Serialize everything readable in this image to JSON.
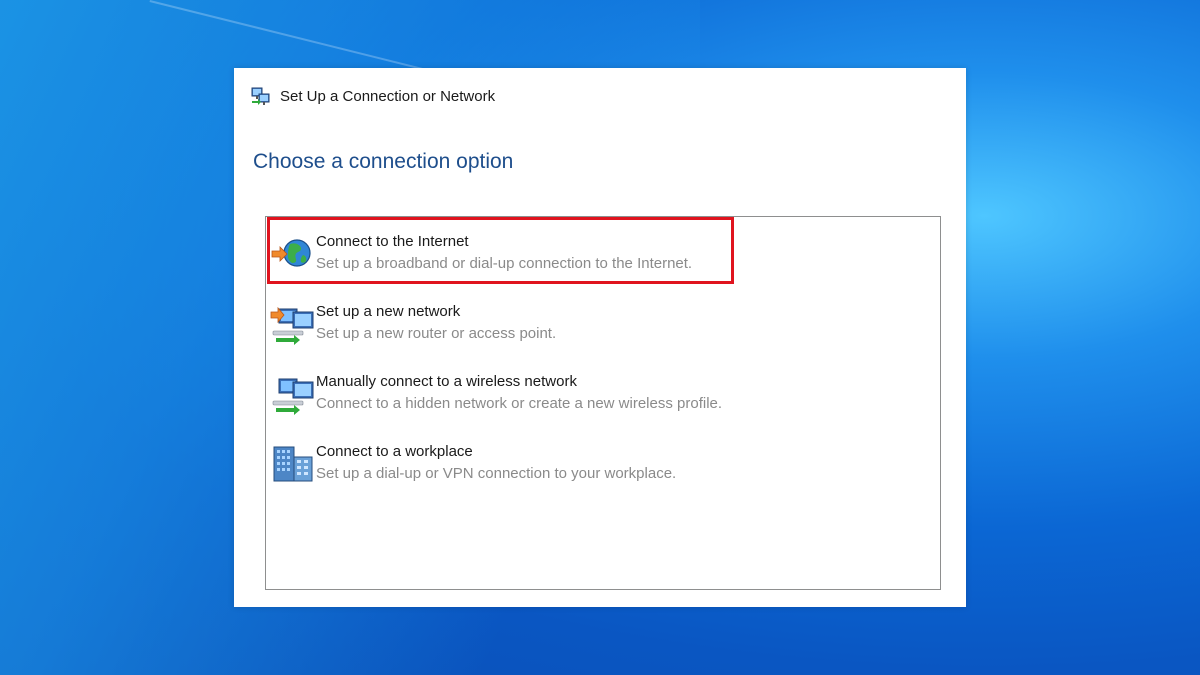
{
  "dialog": {
    "title": "Set Up a Connection or Network",
    "title_icon": "network-setup-icon",
    "heading": "Choose a connection option"
  },
  "options": [
    {
      "title": "Connect to the Internet",
      "description": "Set up a broadband or dial-up connection to the Internet.",
      "icon": "globe-internet-icon",
      "highlighted": true
    },
    {
      "title": "Set up a new network",
      "description": "Set up a new router or access point.",
      "icon": "new-network-icon",
      "highlighted": false
    },
    {
      "title": "Manually connect to a wireless network",
      "description": "Connect to a hidden network or create a new wireless profile.",
      "icon": "wireless-network-icon",
      "highlighted": false
    },
    {
      "title": "Connect to a workplace",
      "description": "Set up a dial-up or VPN connection to your workplace.",
      "icon": "workplace-building-icon",
      "highlighted": false
    }
  ],
  "colors": {
    "heading": "#1e4e8c",
    "highlight_border": "#e0141e",
    "description_text": "#8a8a8a"
  }
}
